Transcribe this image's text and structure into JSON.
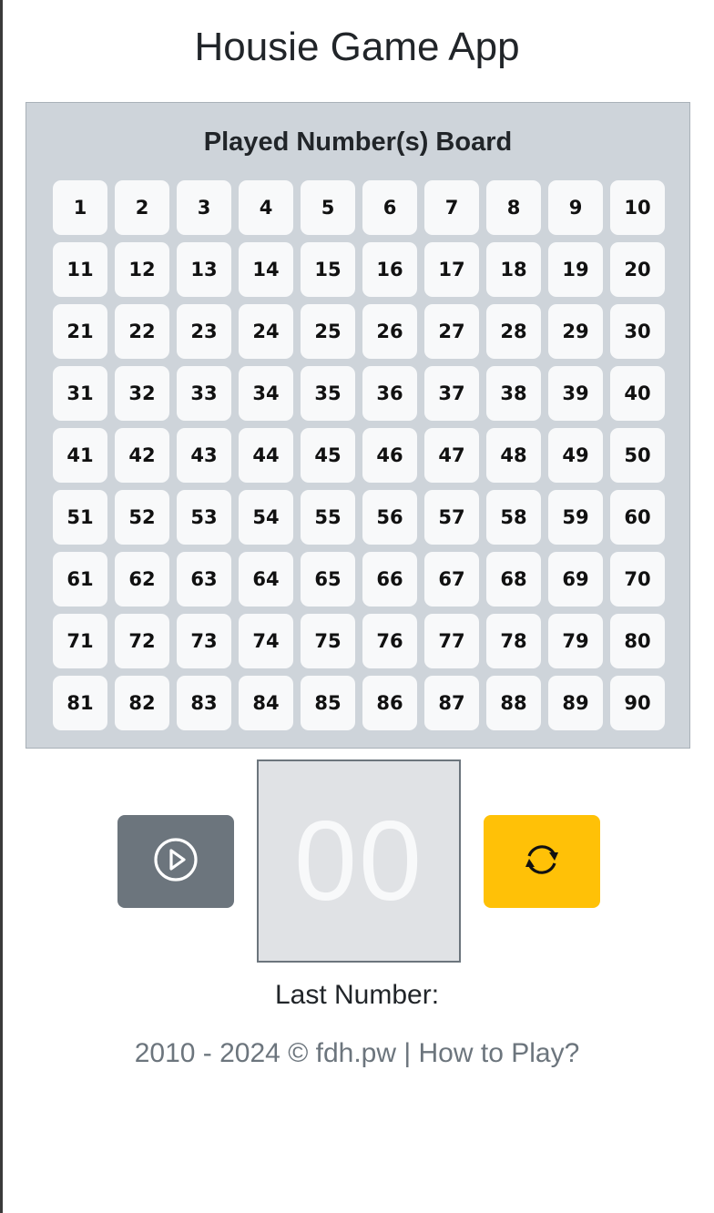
{
  "app": {
    "title": "Housie Game App"
  },
  "board": {
    "title": "Played Number(s) Board",
    "numbers": [
      "1",
      "2",
      "3",
      "4",
      "5",
      "6",
      "7",
      "8",
      "9",
      "10",
      "11",
      "12",
      "13",
      "14",
      "15",
      "16",
      "17",
      "18",
      "19",
      "20",
      "21",
      "22",
      "23",
      "24",
      "25",
      "26",
      "27",
      "28",
      "29",
      "30",
      "31",
      "32",
      "33",
      "34",
      "35",
      "36",
      "37",
      "38",
      "39",
      "40",
      "41",
      "42",
      "43",
      "44",
      "45",
      "46",
      "47",
      "48",
      "49",
      "50",
      "51",
      "52",
      "53",
      "54",
      "55",
      "56",
      "57",
      "58",
      "59",
      "60",
      "61",
      "62",
      "63",
      "64",
      "65",
      "66",
      "67",
      "68",
      "69",
      "70",
      "71",
      "72",
      "73",
      "74",
      "75",
      "76",
      "77",
      "78",
      "79",
      "80",
      "81",
      "82",
      "83",
      "84",
      "85",
      "86",
      "87",
      "88",
      "89",
      "90"
    ]
  },
  "controls": {
    "play_icon": "play-circle-icon",
    "refresh_icon": "refresh-arrows-icon",
    "current_number": "00",
    "play_color": "#6c757d",
    "refresh_color": "#ffc107"
  },
  "status": {
    "last_number_label": "Last Number:"
  },
  "footer": {
    "copyright": "2010 - 2024 © fdh.pw",
    "separator": "|",
    "how_to_play": "How to Play?"
  }
}
